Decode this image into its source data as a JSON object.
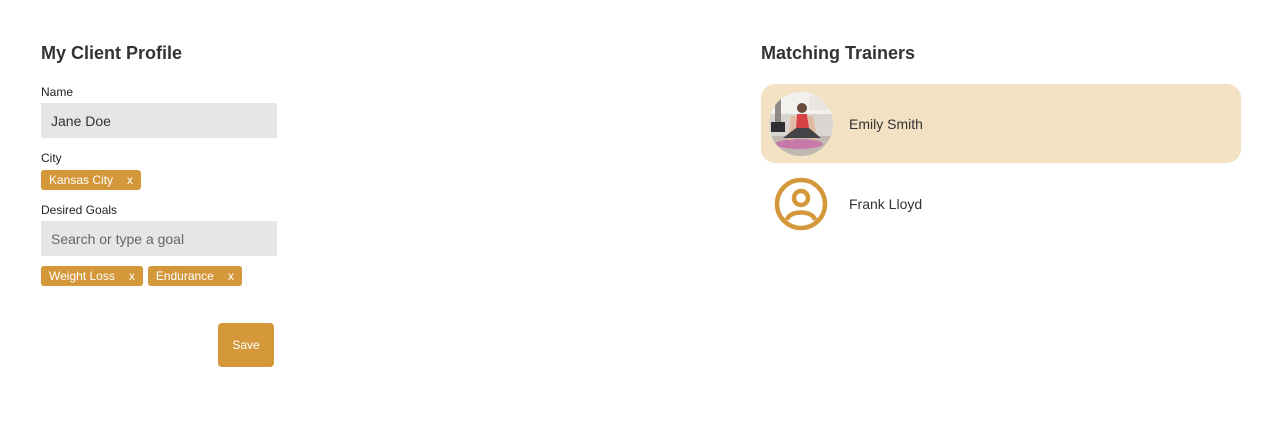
{
  "profile": {
    "title": "My Client Profile",
    "name_label": "Name",
    "name_value": "Jane Doe",
    "city_label": "City",
    "city_chips": [
      {
        "label": "Kansas City",
        "remove": "x"
      }
    ],
    "goals_label": "Desired Goals",
    "goals_placeholder": "Search or type a goal",
    "goal_chips": [
      {
        "label": "Weight Loss",
        "remove": "x"
      },
      {
        "label": "Endurance",
        "remove": "x"
      }
    ],
    "save_label": "Save"
  },
  "trainers": {
    "title": "Matching Trainers",
    "items": [
      {
        "name": "Emily Smith",
        "avatar": "trainer-photo",
        "selected": true
      },
      {
        "name": "Frank Lloyd",
        "avatar": "user-circle-icon",
        "selected": false
      }
    ]
  },
  "colors": {
    "accent": "#d4983a",
    "selected_card": "#f2e1c3",
    "input_bg": "#e6e6e6"
  }
}
